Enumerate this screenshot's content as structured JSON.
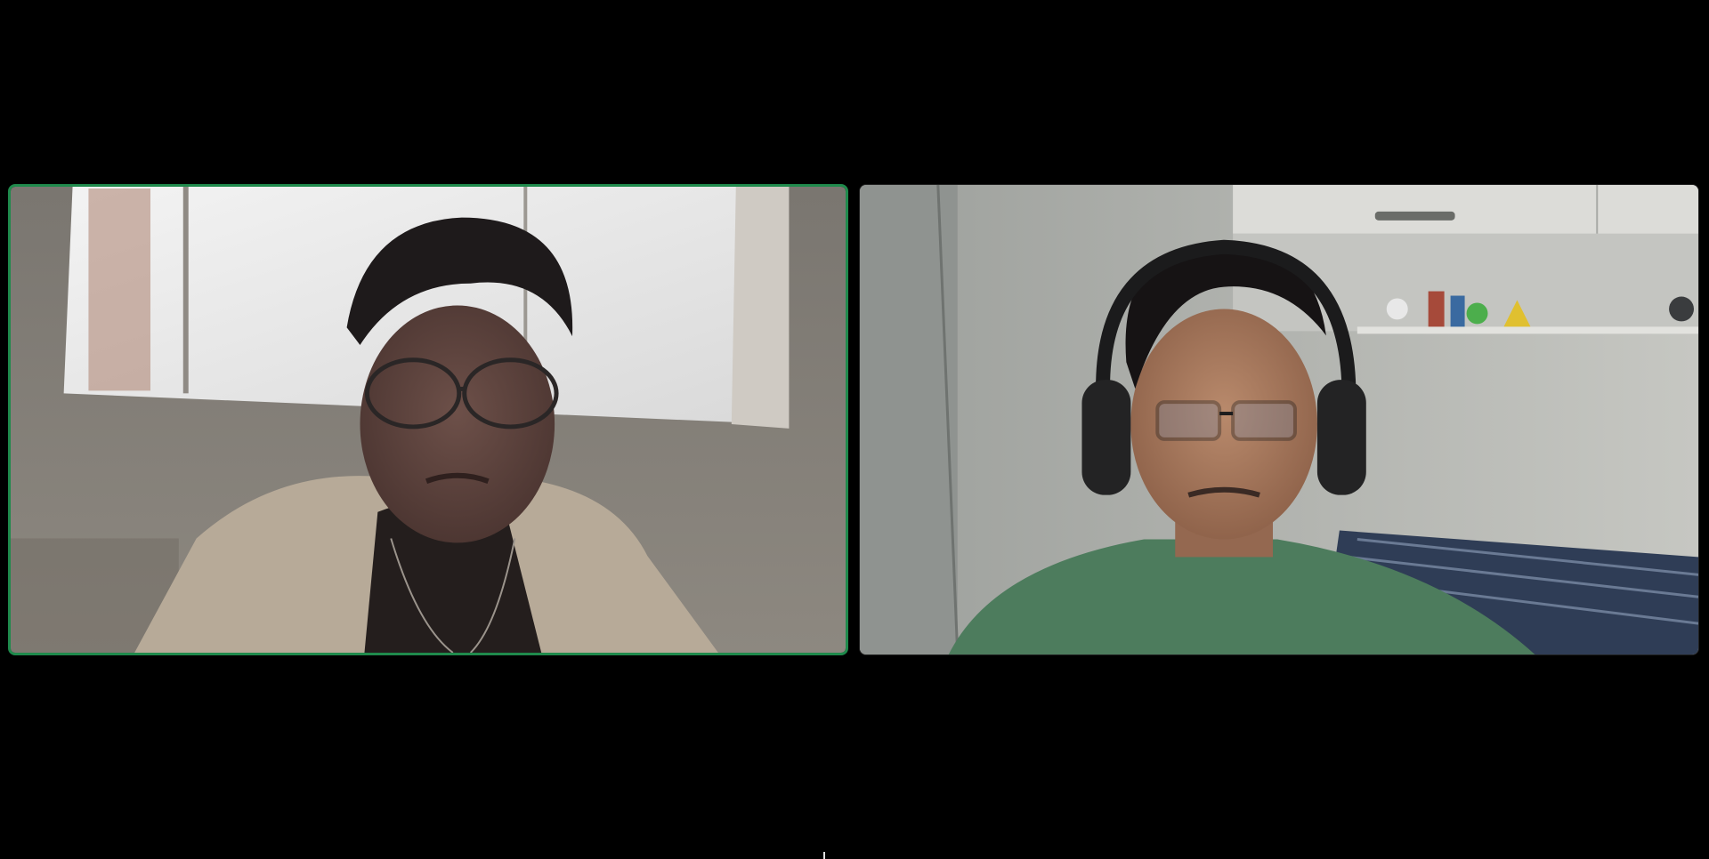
{
  "meeting": {
    "layout": "gallery",
    "active_speaker_color": "#1f8a4c",
    "background_color": "#000000"
  },
  "participants": [
    {
      "position": "left",
      "active_speaker": true,
      "video_on": true
    },
    {
      "position": "right",
      "active_speaker": false,
      "video_on": true
    }
  ]
}
